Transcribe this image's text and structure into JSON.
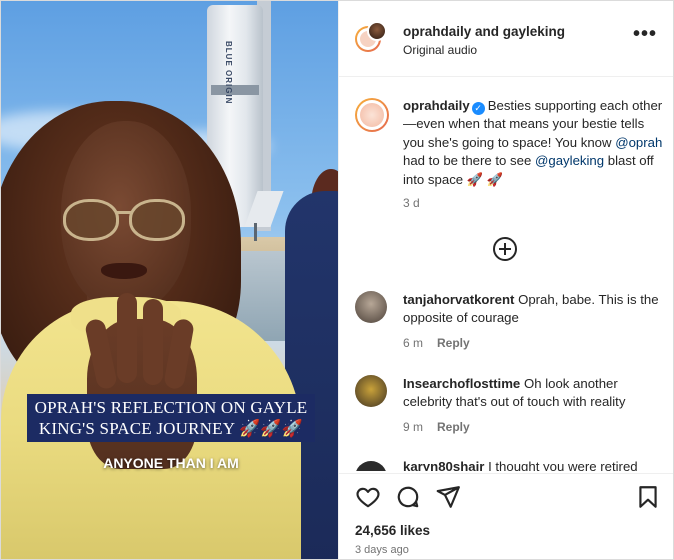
{
  "post": {
    "header": {
      "title": "oprahdaily and gayleking",
      "subtitle": "Original audio",
      "more_label": "•••"
    },
    "caption": {
      "username": "oprahdaily",
      "text_1": "Besties supporting each other—even when that means your bestie tells you she's going to space! You know ",
      "mention_1": "@oprah",
      "text_2": " had to be there to see ",
      "mention_2": "@gayleking",
      "text_3": " blast off into space 🚀 🚀",
      "time": "3 d"
    },
    "comments": [
      {
        "username": "tanjahorvatkorent",
        "text": "Oprah, babe. This is the opposite of courage",
        "time": "6 m",
        "reply_label": "Reply"
      },
      {
        "username": "Insearchoflosttime",
        "text": "Oh look another celebrity that's out of touch with reality",
        "time": "9 m",
        "reply_label": "Reply"
      },
      {
        "username": "karyn80shair",
        "text": "I thought you were retired"
      }
    ],
    "likes": "24,656 likes",
    "posted_ago": "3 days ago"
  },
  "video": {
    "overlay_caption": "OPRAH'S REFLECTION ON GAYLE KING'S SPACE JOURNEY 🚀🚀🚀",
    "subtitle": "ANYONE THAN I AM",
    "rocket_text": "BLUE ORIGIN"
  },
  "icons": {
    "like": "heart-icon",
    "comment": "comment-icon",
    "share": "paper-plane-icon",
    "save": "bookmark-icon",
    "load_more": "plus-circle-icon",
    "verified": "verified-badge-icon"
  },
  "colors": {
    "verified": "#1a8cff",
    "mention": "#00376b",
    "caption_bg": "#1c2b63",
    "ring_start": "#f7b03c",
    "ring_end": "#e5684f"
  }
}
